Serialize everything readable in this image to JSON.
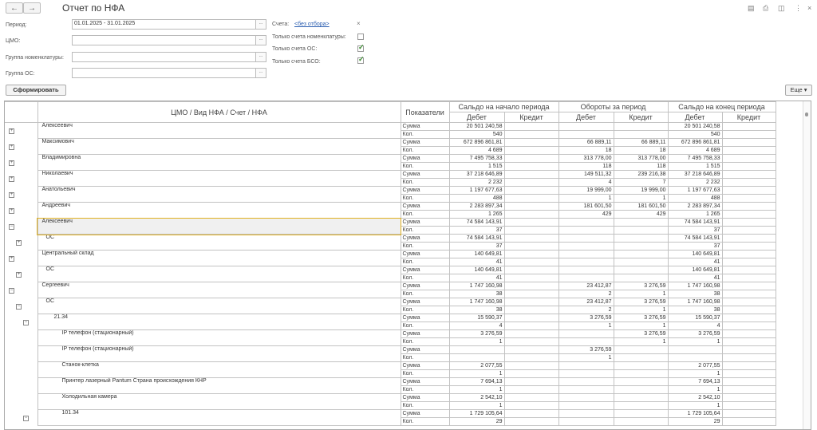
{
  "header": {
    "back": "←",
    "forward": "→",
    "title": "Отчет по НФА",
    "icons": [
      "save-icon",
      "print-icon",
      "preview-icon",
      "more-icon",
      "close-icon"
    ],
    "icon_glyphs": [
      "▤",
      "⎙",
      "◫",
      "⋮",
      "×"
    ]
  },
  "form": {
    "period_label": "Период:",
    "period_value": "01.01.2025 - 31.01.2025",
    "cmo_label": "ЦМО:",
    "cmo_value": "",
    "group_nom_label": "Группа номенклатуры:",
    "group_nom_value": "",
    "group_os_label": "Группа ОС:",
    "group_os_value": "",
    "select_glyph": "...",
    "accounts_label": "Счета:",
    "accounts_link": "<без отбора>",
    "accounts_clear": "×",
    "only_nom_label": "Только счета номенклатуры:",
    "only_nom_checked": false,
    "only_os_label": "Только счета ОС:",
    "only_os_checked": true,
    "only_bso_label": "Только счета БСО:",
    "only_bso_checked": true
  },
  "toolbar": {
    "generate_label": "Сформировать",
    "more_label": "Еще ▾"
  },
  "report": {
    "col_name": "ЦМО / Вид НФА / Счет / НФА",
    "col_ind": "Показатели",
    "groups": [
      "Сальдо на начало периода",
      "Обороты за период",
      "Сальдо на конец периода"
    ],
    "debit": "Дебет",
    "credit": "Кредит",
    "rows": [
      {
        "name": "Алексеевич",
        "ind": [
          "Сумма",
          "Кол."
        ],
        "sd": [
          "20 501 240,58",
          "540"
        ],
        "sk": [
          "",
          ""
        ],
        "od": [
          "",
          ""
        ],
        "ok": [
          "",
          ""
        ],
        "ed": [
          "20 501 240,58",
          "540"
        ],
        "ek": [
          "",
          ""
        ]
      },
      {
        "name": "Максимович",
        "ind": [
          "Сумма",
          "Кол."
        ],
        "sd": [
          "672 896 861,81",
          "4 689"
        ],
        "sk": [
          "",
          ""
        ],
        "od": [
          "66 889,11",
          "18"
        ],
        "ok": [
          "66 889,11",
          "18"
        ],
        "ed": [
          "672 896 861,81",
          "4 689"
        ],
        "ek": [
          "",
          ""
        ]
      },
      {
        "name": "Владимировна",
        "ind": [
          "Сумма",
          "Кол."
        ],
        "sd": [
          "7 495 758,33",
          "1 515"
        ],
        "sk": [
          "",
          ""
        ],
        "od": [
          "313 778,00",
          "118"
        ],
        "ok": [
          "313 778,00",
          "118"
        ],
        "ed": [
          "7 495 758,33",
          "1 515"
        ],
        "ek": [
          "",
          ""
        ]
      },
      {
        "name": "Николаевич",
        "ind": [
          "Сумма",
          "Кол."
        ],
        "sd": [
          "37 218 646,89",
          "2 232"
        ],
        "sk": [
          "",
          ""
        ],
        "od": [
          "149 511,32",
          "4"
        ],
        "ok": [
          "239 216,38",
          "7"
        ],
        "ed": [
          "37 218 646,89",
          "2 232"
        ],
        "ek": [
          "",
          ""
        ]
      },
      {
        "name": "Анатольевич",
        "ind": [
          "Сумма",
          "Кол."
        ],
        "sd": [
          "1 197 677,63",
          "488"
        ],
        "sk": [
          "",
          ""
        ],
        "od": [
          "19 999,00",
          "1"
        ],
        "ok": [
          "19 999,00",
          "1"
        ],
        "ed": [
          "1 197 677,63",
          "488"
        ],
        "ek": [
          "",
          ""
        ]
      },
      {
        "name": "Андреевич",
        "ind": [
          "Сумма",
          "Кол."
        ],
        "sd": [
          "2 283 897,34",
          "1 265"
        ],
        "sk": [
          "",
          ""
        ],
        "od": [
          "181 601,50",
          "429"
        ],
        "ok": [
          "181 601,50",
          "429"
        ],
        "ed": [
          "2 283 897,34",
          "1 265"
        ],
        "ek": [
          "",
          ""
        ]
      },
      {
        "name": "Алексеевич",
        "ind": [
          "Сумма",
          "Кол."
        ],
        "sd": [
          "74 584 143,91",
          "37"
        ],
        "sk": [
          "",
          ""
        ],
        "od": [
          "",
          ""
        ],
        "ok": [
          "",
          ""
        ],
        "ed": [
          "74 584 143,91",
          "37"
        ],
        "ek": [
          "",
          ""
        ]
      },
      {
        "name": "ОС",
        "ind": [
          "Сумма",
          "Кол."
        ],
        "sd": [
          "74 584 143,91",
          "37"
        ],
        "sk": [
          "",
          ""
        ],
        "od": [
          "",
          ""
        ],
        "ok": [
          "",
          ""
        ],
        "ed": [
          "74 584 143,91",
          "37"
        ],
        "ek": [
          "",
          ""
        ]
      },
      {
        "name": "Центральный склад",
        "ind": [
          "Сумма",
          "Кол."
        ],
        "sd": [
          "140 649,81",
          "41"
        ],
        "sk": [
          "",
          ""
        ],
        "od": [
          "",
          ""
        ],
        "ok": [
          "",
          ""
        ],
        "ed": [
          "140 649,81",
          "41"
        ],
        "ek": [
          "",
          ""
        ]
      },
      {
        "name": "ОС",
        "ind": [
          "Сумма",
          "Кол."
        ],
        "sd": [
          "140 649,81",
          "41"
        ],
        "sk": [
          "",
          ""
        ],
        "od": [
          "",
          ""
        ],
        "ok": [
          "",
          ""
        ],
        "ed": [
          "140 649,81",
          "41"
        ],
        "ek": [
          "",
          ""
        ]
      },
      {
        "name": "Сергеевич",
        "ind": [
          "Сумма",
          "Кол."
        ],
        "sd": [
          "1 747 160,98",
          "38"
        ],
        "sk": [
          "",
          ""
        ],
        "od": [
          "23 412,87",
          "2"
        ],
        "ok": [
          "3 276,59",
          "1"
        ],
        "ed": [
          "1 747 160,98",
          "38"
        ],
        "ek": [
          "",
          ""
        ]
      },
      {
        "name": "ОС",
        "ind": [
          "Сумма",
          "Кол."
        ],
        "sd": [
          "1 747 160,98",
          "38"
        ],
        "sk": [
          "",
          ""
        ],
        "od": [
          "23 412,87",
          "2"
        ],
        "ok": [
          "3 276,59",
          "1"
        ],
        "ed": [
          "1 747 160,98",
          "38"
        ],
        "ek": [
          "",
          ""
        ]
      },
      {
        "name": "21.34",
        "ind": [
          "Сумма",
          "Кол."
        ],
        "sd": [
          "15 590,37",
          "4"
        ],
        "sk": [
          "",
          ""
        ],
        "od": [
          "3 276,59",
          "1"
        ],
        "ok": [
          "3 276,59",
          "1"
        ],
        "ed": [
          "15 590,37",
          "4"
        ],
        "ek": [
          "",
          ""
        ]
      },
      {
        "name": "IP телефон (стационарный)",
        "ind": [
          "Сумма",
          "Кол."
        ],
        "sd": [
          "3 276,59",
          "1"
        ],
        "sk": [
          "",
          ""
        ],
        "od": [
          "",
          ""
        ],
        "ok": [
          "3 276,59",
          "1"
        ],
        "ed": [
          "3 276,59",
          "1"
        ],
        "ek": [
          "",
          ""
        ]
      },
      {
        "name": "IP телефон (стационарный)",
        "ind": [
          "Сумма",
          "Кол."
        ],
        "sd": [
          "",
          ""
        ],
        "sk": [
          "",
          ""
        ],
        "od": [
          "3 276,59",
          "1"
        ],
        "ok": [
          "",
          ""
        ],
        "ed": [
          "",
          ""
        ],
        "ek": [
          "",
          ""
        ]
      },
      {
        "name": "Станок-клетка",
        "ind": [
          "Сумма",
          "Кол."
        ],
        "sd": [
          "2 077,55",
          "1"
        ],
        "sk": [
          "",
          ""
        ],
        "od": [
          "",
          ""
        ],
        "ok": [
          "",
          ""
        ],
        "ed": [
          "2 077,55",
          "1"
        ],
        "ek": [
          "",
          ""
        ]
      },
      {
        "name": "Принтер лазерный Pantum  Страна происхождения КНР",
        "ind": [
          "Сумма",
          "Кол."
        ],
        "sd": [
          "7 694,13",
          "1"
        ],
        "sk": [
          "",
          ""
        ],
        "od": [
          "",
          ""
        ],
        "ok": [
          "",
          ""
        ],
        "ed": [
          "7 694,13",
          "1"
        ],
        "ek": [
          "",
          ""
        ]
      },
      {
        "name": "Холодильная камера",
        "ind": [
          "Сумма",
          "Кол."
        ],
        "sd": [
          "2 542,10",
          "1"
        ],
        "sk": [
          "",
          ""
        ],
        "od": [
          "",
          ""
        ],
        "ok": [
          "",
          ""
        ],
        "ed": [
          "2 542,10",
          "1"
        ],
        "ek": [
          "",
          ""
        ]
      },
      {
        "name": "101.34",
        "ind": [
          "Сумма",
          "Кол."
        ],
        "sd": [
          "1 729 105,64",
          "29"
        ],
        "sk": [
          "",
          ""
        ],
        "od": [
          "",
          ""
        ],
        "ok": [
          "",
          ""
        ],
        "ed": [
          "1 729 105,64",
          "29"
        ],
        "ek": [
          "",
          ""
        ]
      }
    ]
  }
}
